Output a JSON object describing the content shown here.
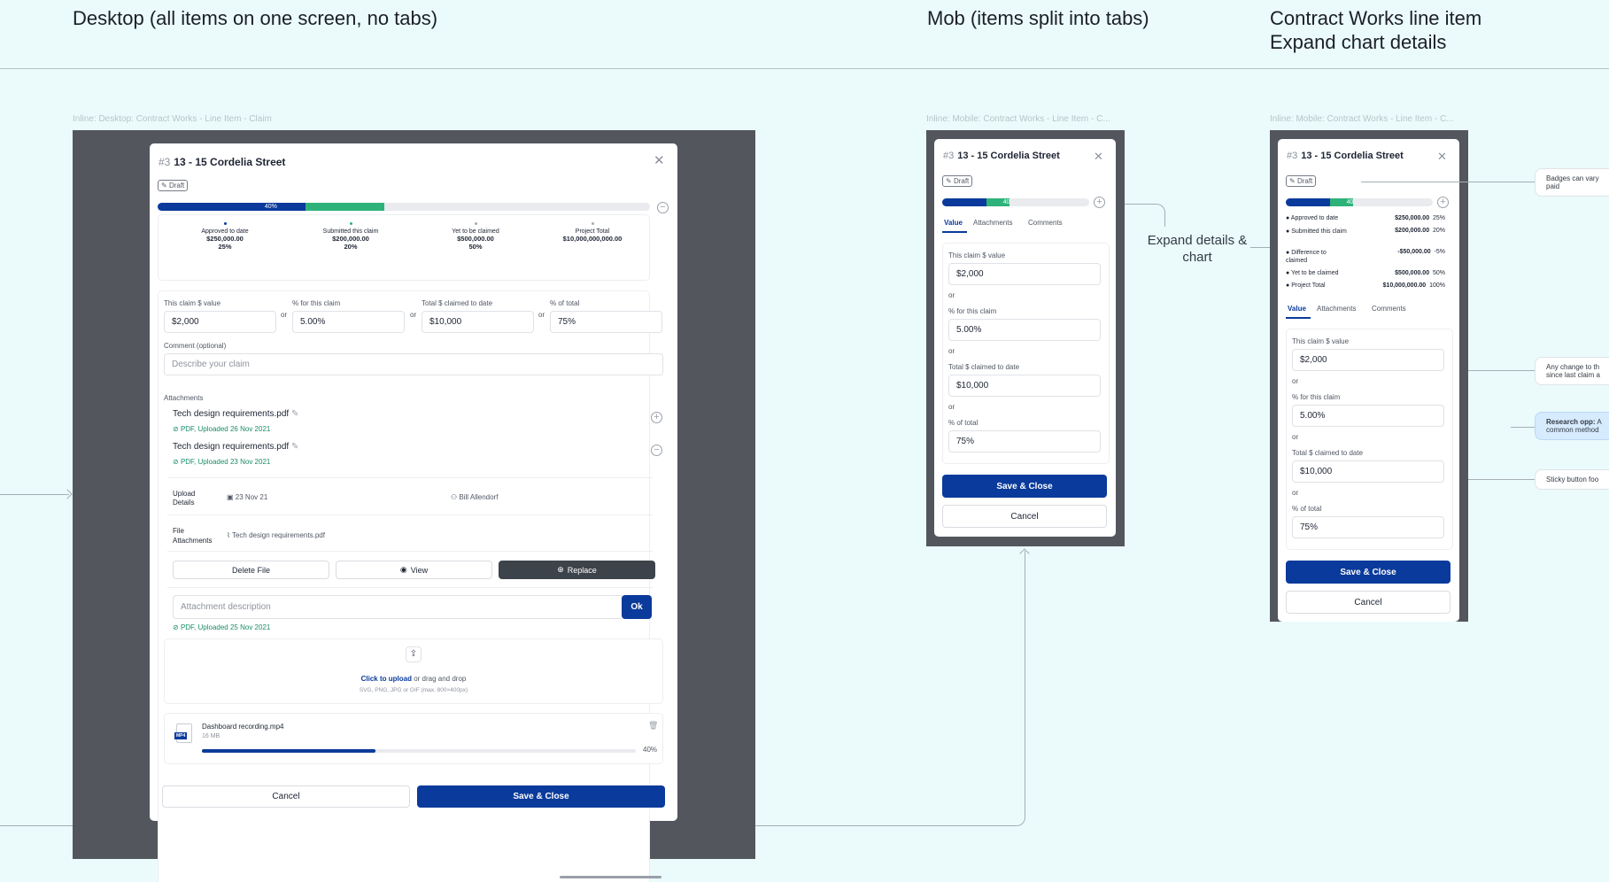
{
  "headings": {
    "desktop": "Desktop (all items on one screen, no tabs)",
    "mobile": "Mob  (items split into tabs)",
    "contract_line1": "Contract Works line item",
    "contract_line2": "Expand chart details"
  },
  "frame_labels": {
    "desktop": "Inline: Desktop: Contract Works - Line Item - Claim",
    "mobile": "Inline: Mobile: Contract Works - Line Item - C...",
    "mobile2": "Inline: Mobile: Contract Works - Line Item - C..."
  },
  "item": {
    "number": "#3",
    "title": "13 - 15 Cordelia Street",
    "badge": "Draft",
    "progress_label": "40%",
    "progress_label_short": "40"
  },
  "colors": {
    "blue": "#0a3a9b",
    "green": "#2db37a",
    "track": "#e9ebee"
  },
  "progress": {
    "approved": 0.3,
    "submitted": 0.16
  },
  "stats": [
    {
      "label": "Approved to date",
      "value": "$250,000.00",
      "pct": "25%",
      "color": "#0a3a9b"
    },
    {
      "label": "Submitted this claim",
      "value": "$200,000.00",
      "pct": "20%",
      "color": "#2db37a"
    },
    {
      "label": "Yet to be claimed",
      "value": "$500,000.00",
      "pct": "50%",
      "color": "#a6acb4"
    },
    {
      "label": "Project Total",
      "value": "$10,000,000,000.00",
      "pct": "",
      "color": "#a6acb4"
    }
  ],
  "fields": {
    "claim_value_label": "This claim $ value",
    "claim_value": "$2,000",
    "pct_claim_label": "% for this claim",
    "pct_claim": "5.00%",
    "total_label": "Total $ claimed to date",
    "total": "$10,000",
    "pct_total_label": "% of total",
    "pct_total": "75%",
    "or": "or",
    "comment_label": "Comment (optional)",
    "comment_placeholder": "Describe your claim"
  },
  "attachments": {
    "title": "Attachments",
    "files": [
      {
        "name": "Tech design requirements.pdf",
        "meta": "PDF, Uploaded 26 Nov 2021"
      },
      {
        "name": "Tech design requirements.pdf",
        "meta": "PDF, Uploaded 23 Nov 2021"
      }
    ],
    "upload_details_label1": "Upload",
    "upload_details_label2": "Details",
    "upload_date": "23 Nov 21",
    "uploader": "Bill Allendorf",
    "file_attachments_label1": "File",
    "file_attachments_label2": "Attachments",
    "file_attachment_name": "Tech design requirements.pdf",
    "delete_label": "Delete File",
    "view_label": "View",
    "replace_label": "Replace",
    "desc_placeholder": "Attachment description",
    "ok_label": "Ok",
    "new_meta": "PDF, Uploaded 25 Nov 2021",
    "upload_link": "Click to upload",
    "upload_rest": "or drag and drop",
    "upload_hint": "SVG, PNG, JPG or GIF (max. 800×400px)",
    "recording_name": "Dashboard recording.mp4",
    "recording_size": "16 MB",
    "recording_ext": "MP4",
    "recording_progress": 0.4,
    "recording_pct": "40%"
  },
  "buttons": {
    "cancel": "Cancel",
    "save_close": "Save & Close"
  },
  "tabs": [
    "Value",
    "Attachments",
    "Comments"
  ],
  "expand_lines": [
    {
      "label": "Approved to date",
      "value": "$250,000.00",
      "pct": "25%"
    },
    {
      "label": "Submitted this claim",
      "value": "$200,000.00",
      "pct": "20%"
    },
    {
      "label": "Difference to claimed",
      "value": "-$50,000.00",
      "pct": "-5%"
    },
    {
      "label": "Yet to be claimed",
      "value": "$500,000.00",
      "pct": "50%"
    },
    {
      "label": "Project Total",
      "value": "$10,000,000.00",
      "pct": "100%"
    }
  ],
  "annotations": {
    "expand": "Expand details & chart",
    "badges_1": "Badges can vary",
    "badges_2": "paid",
    "change_1": "Any change to th",
    "change_2": "since last claim a",
    "research_bold": "Research opp:",
    "research_rest": " A",
    "research_2": "common method",
    "sticky": "Sticky button foo"
  }
}
